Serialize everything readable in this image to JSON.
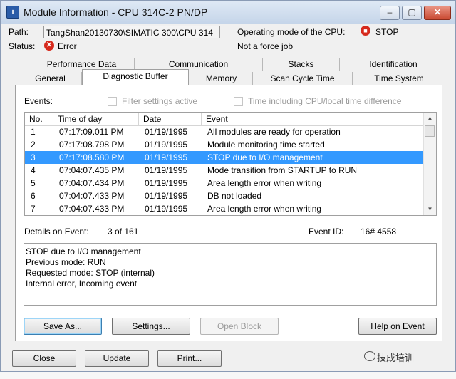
{
  "window": {
    "title": "Module Information - CPU 314C-2 PN/DP"
  },
  "header": {
    "path_label": "Path:",
    "path_value": "TangShan20130730\\SIMATIC 300\\CPU 314",
    "status_label": "Status:",
    "status_value": "Error",
    "operating_mode_label": "Operating mode of the  CPU:",
    "operating_mode_value": "STOP",
    "force_text": "Not a force job"
  },
  "tabs": {
    "row1": [
      "Performance Data",
      "Communication",
      "Stacks",
      "Identification"
    ],
    "row2": [
      "General",
      "Diagnostic Buffer",
      "Memory",
      "Scan Cycle Time",
      "Time System"
    ],
    "active": "Diagnostic Buffer"
  },
  "events": {
    "label": "Events:",
    "filter_checkbox": "Filter settings active",
    "time_checkbox": "Time including CPU/local time difference",
    "columns": [
      "No.",
      "Time of day",
      "Date",
      "Event"
    ],
    "rows": [
      {
        "no": "1",
        "time": "07:17:09.011 PM",
        "date": "01/19/1995",
        "event": "All modules are ready for operation"
      },
      {
        "no": "2",
        "time": "07:17:08.798 PM",
        "date": "01/19/1995",
        "event": "Module monitoring time started"
      },
      {
        "no": "3",
        "time": "07:17:08.580 PM",
        "date": "01/19/1995",
        "event": "STOP due to I/O management"
      },
      {
        "no": "4",
        "time": "07:04:07.435 PM",
        "date": "01/19/1995",
        "event": "Mode transition from STARTUP to RUN"
      },
      {
        "no": "5",
        "time": "07:04:07.434 PM",
        "date": "01/19/1995",
        "event": "Area length error when writing"
      },
      {
        "no": "6",
        "time": "07:04:07.433 PM",
        "date": "01/19/1995",
        "event": "DB not loaded"
      },
      {
        "no": "7",
        "time": "07:04:07.433 PM",
        "date": "01/19/1995",
        "event": "Area length error when writing"
      }
    ],
    "selected_row": 3
  },
  "details": {
    "label": "Details on Event:",
    "position": "3 of 161",
    "event_id_label": "Event ID:",
    "event_id_value": "16# 4558",
    "lines": [
      "STOP due to I/O management",
      "Previous mode: RUN",
      "Requested mode: STOP (internal)",
      "Internal error, Incoming event"
    ]
  },
  "buttons": {
    "save_as": "Save As...",
    "settings": "Settings...",
    "open_block": "Open Block",
    "help_on_event": "Help on Event",
    "close": "Close",
    "update": "Update",
    "print": "Print..."
  },
  "watermark": {
    "text": "技成培训"
  },
  "icons": {
    "title": "module-info-icon",
    "stop": "stop-icon",
    "error": "error-icon",
    "watermark": "wechat-icon"
  }
}
